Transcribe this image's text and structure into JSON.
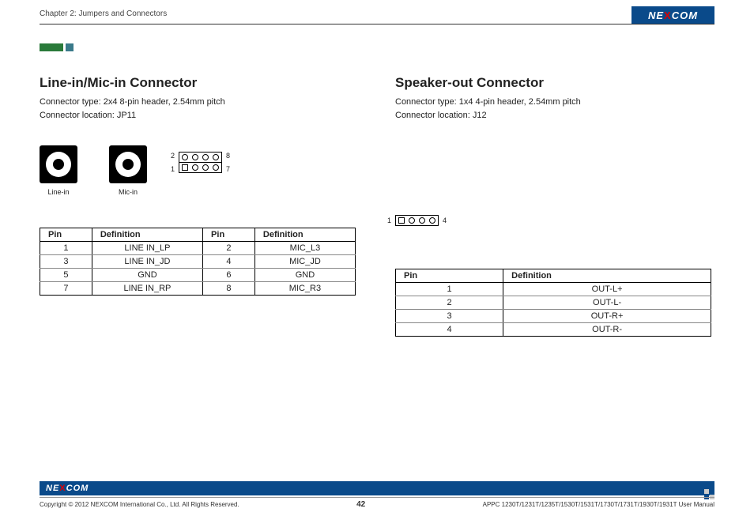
{
  "header": {
    "chapter": "Chapter 2: Jumpers and Connectors",
    "logo": "NEXCOM"
  },
  "left": {
    "title": "Line-in/Mic-in Connector",
    "desc1": "Connector type: 2x4 8-pin header, 2.54mm pitch",
    "desc2": "Connector location: JP11",
    "jack1": "Line-in",
    "jack2": "Mic-in",
    "pinlabels": {
      "tl": "2",
      "tr": "8",
      "bl": "1",
      "br": "7"
    },
    "table": {
      "h1": "Pin",
      "h2": "Definition",
      "h3": "Pin",
      "h4": "Definition",
      "rows": [
        {
          "p1": "1",
          "d1": "LINE IN_LP",
          "p2": "2",
          "d2": "MIC_L3"
        },
        {
          "p1": "3",
          "d1": "LINE IN_JD",
          "p2": "4",
          "d2": "MIC_JD"
        },
        {
          "p1": "5",
          "d1": "GND",
          "p2": "6",
          "d2": "GND"
        },
        {
          "p1": "7",
          "d1": "LINE IN_RP",
          "p2": "8",
          "d2": "MIC_R3"
        }
      ]
    }
  },
  "right": {
    "title": "Speaker-out Connector",
    "desc1": "Connector type: 1x4 4-pin header, 2.54mm pitch",
    "desc2": "Connector location: J12",
    "pinlabels": {
      "l": "1",
      "r": "4"
    },
    "table": {
      "h1": "Pin",
      "h2": "Definition",
      "rows": [
        {
          "p": "1",
          "d": "OUT-L+"
        },
        {
          "p": "2",
          "d": "OUT-L-"
        },
        {
          "p": "3",
          "d": "OUT-R+"
        },
        {
          "p": "4",
          "d": "OUT-R-"
        }
      ]
    }
  },
  "footer": {
    "copyright": "Copyright © 2012 NEXCOM International Co., Ltd. All Rights Reserved.",
    "page": "42",
    "manual": "APPC 1230T/1231T/1235T/1530T/1531T/1730T/1731T/1930T/1931T User Manual"
  }
}
